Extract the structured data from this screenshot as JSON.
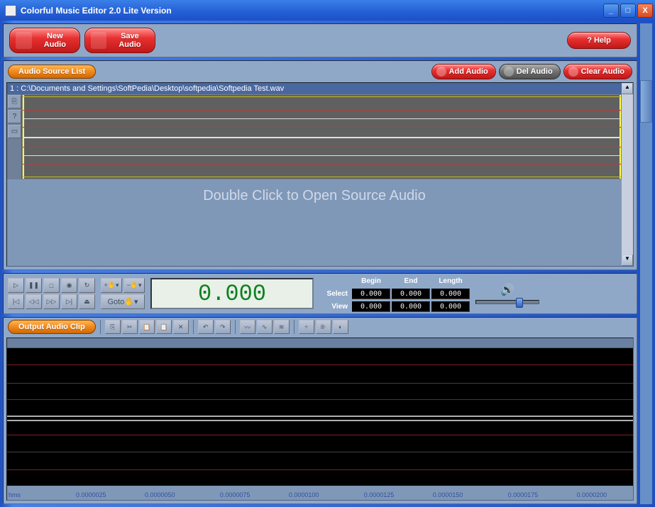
{
  "window": {
    "title": "Colorful Music Editor 2.0 Lite Version"
  },
  "toolbar": {
    "new_audio": "New Audio",
    "save_audio": "Save Audio",
    "help": "?  Help"
  },
  "source": {
    "label": "Audio Source List",
    "add": "Add Audio",
    "del": "Del Audio",
    "clear": "Clear Audio",
    "file": "1 : C:\\Documents and Settings\\SoftPedia\\Desktop\\softpedia\\Softpedia Test.wav",
    "hint": "Double Click to Open Source Audio"
  },
  "transport": {
    "time": "0.000",
    "goto": "Goto",
    "headers": {
      "begin": "Begin",
      "end": "End",
      "length": "Length"
    },
    "rows": {
      "select": "Select",
      "view": "View"
    },
    "values": {
      "select": {
        "begin": "0.000",
        "end": "0.000",
        "length": "0.000"
      },
      "view": {
        "begin": "0.000",
        "end": "0.000",
        "length": "0.000"
      }
    }
  },
  "output": {
    "label": "Output Audio Clip",
    "ruler_unit": "hms",
    "ticks": [
      "0.0000025",
      "0.0000050",
      "0.0000075",
      "0.0000100",
      "0.0000125",
      "0.0000150",
      "0.0000175",
      "0.0000200"
    ]
  }
}
